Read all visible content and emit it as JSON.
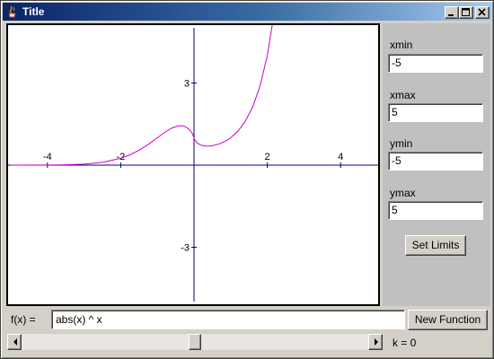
{
  "window": {
    "title": "Title"
  },
  "limits": {
    "xmin_label": "xmin",
    "xmin_value": "-5",
    "xmax_label": "xmax",
    "xmax_value": "5",
    "ymin_label": "ymin",
    "ymin_value": "-5",
    "ymax_label": "ymax",
    "ymax_value": "5",
    "set_button": "Set Limits"
  },
  "function_bar": {
    "label": "f(x) =",
    "expression": "abs(x) ^ x",
    "new_button": "New Function"
  },
  "parameter": {
    "k_label": "k = 0",
    "slider_fraction": 0.5
  },
  "chart_data": {
    "type": "line",
    "xlim": [
      -5,
      5
    ],
    "ylim": [
      -5,
      5
    ],
    "x_ticks": [
      "-4",
      "-2",
      "2",
      "4"
    ],
    "y_ticks": [
      "3",
      "-3"
    ],
    "grid": false,
    "series": [
      {
        "color": "#cc00cc",
        "x": [
          -5.0,
          -4.0,
          -3.5,
          -3.0,
          -2.5,
          -2.0,
          -1.75,
          -1.5,
          -1.25,
          -1.0,
          -0.8,
          -0.6,
          -0.4,
          -0.3,
          -0.2,
          -0.1,
          -0.05,
          0.02,
          0.1,
          0.2,
          0.3,
          0.368,
          0.5,
          0.7,
          0.9,
          1.0,
          1.2,
          1.4,
          1.6,
          1.8,
          2.0,
          2.2
        ],
        "y": [
          0.0003,
          0.0039,
          0.0124,
          0.037,
          0.1012,
          0.25,
          0.3755,
          0.5443,
          0.7568,
          1.0,
          1.1955,
          1.3592,
          1.4427,
          1.4359,
          1.3797,
          1.2589,
          1.1616,
          0.9248,
          0.7943,
          0.7248,
          0.6968,
          0.6922,
          0.7071,
          0.7791,
          0.9095,
          1.0,
          1.2446,
          1.6017,
          2.1213,
          2.8819,
          4.0,
          5.6624
        ]
      }
    ]
  }
}
